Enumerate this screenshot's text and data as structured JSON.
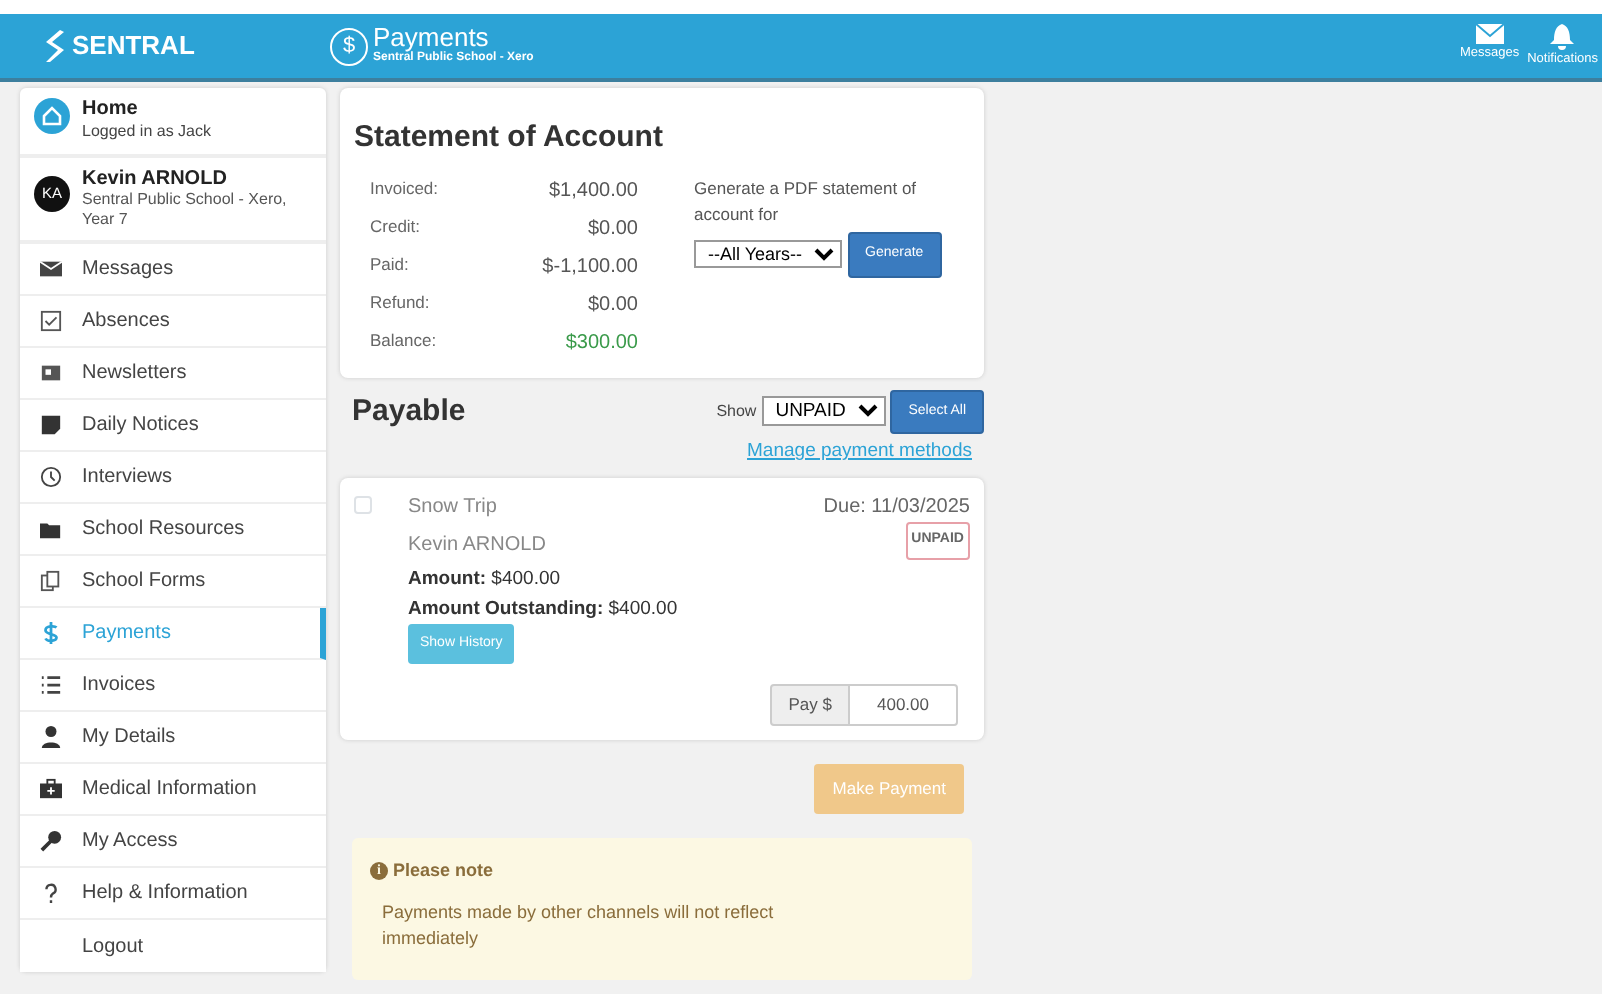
{
  "header": {
    "brand": "SENTRAL",
    "page_icon": "$",
    "title": "Payments",
    "subtitle": "Sentral Public School - Xero",
    "actions": [
      {
        "label": "Messages"
      },
      {
        "label": "Notifications"
      }
    ]
  },
  "sidebar": {
    "home": {
      "title": "Home",
      "subtitle": "Logged in as Jack"
    },
    "student": {
      "initials": "KA",
      "name": "Kevin ARNOLD",
      "subtitle": "Sentral Public School - Xero, Year 7"
    },
    "items": [
      {
        "label": "Messages",
        "selected": false
      },
      {
        "label": "Absences",
        "selected": false
      },
      {
        "label": "Newsletters",
        "selected": false
      },
      {
        "label": "Daily Notices",
        "selected": false
      },
      {
        "label": "Interviews",
        "selected": false
      },
      {
        "label": "School Resources",
        "selected": false
      },
      {
        "label": "School Forms",
        "selected": false
      },
      {
        "label": "Payments",
        "selected": true
      },
      {
        "label": "Invoices",
        "selected": false
      },
      {
        "label": "My Details",
        "selected": false
      },
      {
        "label": "Medical Information",
        "selected": false
      },
      {
        "label": "My Access",
        "selected": false
      },
      {
        "label": "Help & Information",
        "selected": false
      },
      {
        "label": "Logout",
        "selected": false
      }
    ]
  },
  "statement": {
    "title": "Statement of Account",
    "rows": [
      {
        "label": "Invoiced:",
        "value": "$1,400.00",
        "highlight": false
      },
      {
        "label": "Credit:",
        "value": "$0.00",
        "highlight": false
      },
      {
        "label": "Paid:",
        "value": "$-1,100.00",
        "highlight": false
      },
      {
        "label": "Refund:",
        "value": "$0.00",
        "highlight": false
      },
      {
        "label": "Balance:",
        "value": "$300.00",
        "highlight": true
      }
    ],
    "pdf_text": "Generate a PDF statement of account for",
    "year_select": "--All Years--",
    "generate_button": "Generate"
  },
  "payable": {
    "title": "Payable",
    "show_label": "Show",
    "show_select": "UNPAID",
    "select_all_button": "Select All",
    "manage_link": "Manage payment methods",
    "items": [
      {
        "checked": false,
        "title": "Snow Trip",
        "student": "Kevin ARNOLD",
        "due": "Due: 11/03/2025",
        "status": "UNPAID",
        "amount": "**Amount:** $400.00",
        "outstanding": "**Amount Outstanding:** $400.00",
        "history_button": "Show History",
        "pay_label": "Pay $",
        "pay_value": "400.00"
      }
    ],
    "make_payment": {
      "label": "Make Payment",
      "disabled": true
    }
  },
  "note": {
    "icon": "i",
    "title": "Please note",
    "text": "Payments made by other channels will not reflect immediately"
  }
}
